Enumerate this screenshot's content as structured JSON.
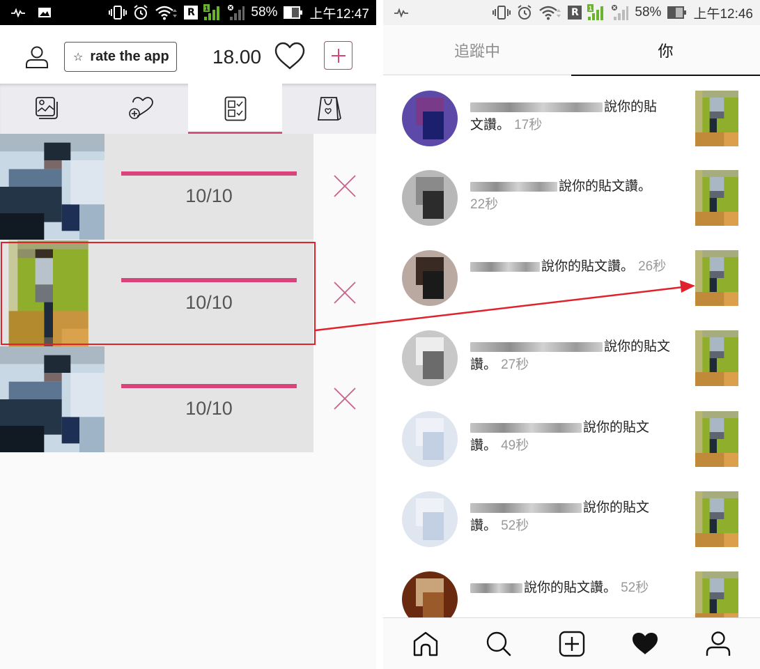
{
  "colors": {
    "accent_pink": "#d9457a",
    "annotation_red": "#e0222c",
    "row_bg": "#e4e4e4",
    "tab_bg": "#ececf0"
  },
  "left_screen": {
    "status_bar": {
      "icons": [
        "activity-icon",
        "image-notification-icon",
        "vibrate-icon",
        "alarm-icon",
        "wifi-icon",
        "roaming-r-icon",
        "signal-sim1-icon",
        "signal-sim2-no-service-icon",
        "battery-icon"
      ],
      "roaming_label": "R",
      "sim_label": "1",
      "battery": "58%",
      "time": "上午12:47"
    },
    "header": {
      "rate_button_label": "rate the app",
      "coins": "18.00"
    },
    "tabs": [
      {
        "icon": "photos-stack-icon",
        "active": false
      },
      {
        "icon": "add-like-icon",
        "active": false
      },
      {
        "icon": "checklist-icon",
        "active": true
      },
      {
        "icon": "shopping-bag-icon",
        "active": false
      }
    ],
    "tasks": [
      {
        "progress_label": "10/10",
        "progress": 1.0,
        "thumbnail": "blurred-photo-blue"
      },
      {
        "progress_label": "10/10",
        "progress": 1.0,
        "thumbnail": "blurred-photo-green",
        "highlighted": true
      },
      {
        "progress_label": "10/10",
        "progress": 1.0,
        "thumbnail": "blurred-photo-blue"
      }
    ]
  },
  "right_screen": {
    "status_bar": {
      "roaming_label": "R",
      "sim_label": "1",
      "battery": "58%",
      "time": "上午12:46"
    },
    "tabs": [
      {
        "label": "追蹤中",
        "active": false
      },
      {
        "label": "你",
        "active": true
      }
    ],
    "notifications": [
      {
        "line1": "說你的貼",
        "line2": "文讚。",
        "time": "17秒",
        "username_blurred": true
      },
      {
        "line1": "說你的貼文讚。",
        "line2": "",
        "time": "22秒",
        "username_blurred": true
      },
      {
        "line1": "說你的貼文讚。",
        "line2": "",
        "time": "26秒",
        "username_blurred": true
      },
      {
        "line1": "說你的貼文",
        "line2": "讚。",
        "time": "27秒",
        "username_blurred": true
      },
      {
        "line1": "說你的貼文",
        "line2": "讚。",
        "time": "49秒",
        "username_blurred": true
      },
      {
        "line1": "說你的貼文",
        "line2": "讚。",
        "time": "52秒",
        "username_blurred": true
      },
      {
        "line1": "說你的貼文讚。",
        "line2": "",
        "time": "52秒",
        "username_blurred": true
      }
    ],
    "bottom_nav": [
      "home-icon",
      "search-icon",
      "new-post-icon",
      "activity-heart-icon",
      "profile-icon"
    ]
  }
}
